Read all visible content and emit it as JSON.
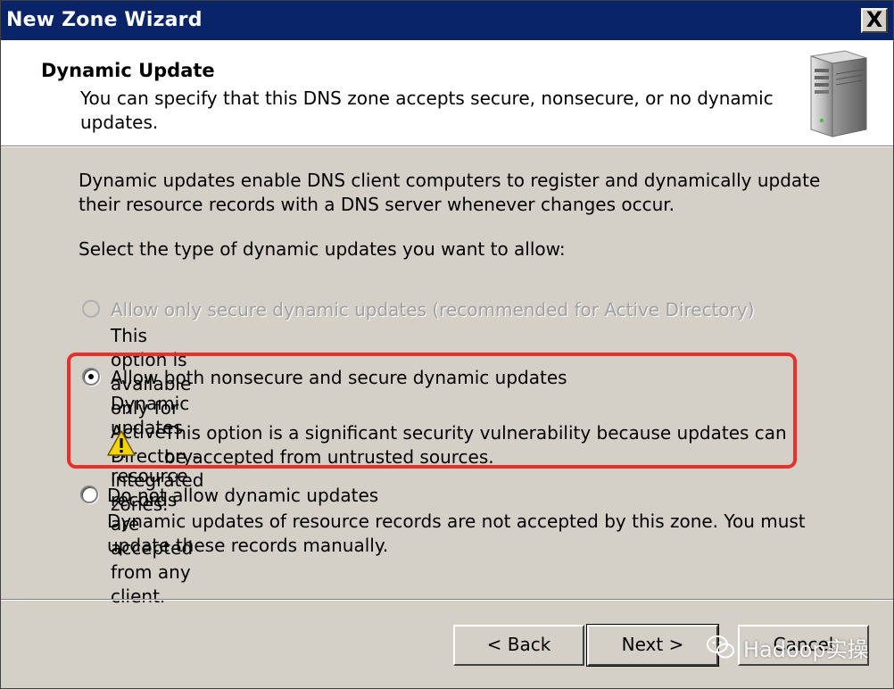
{
  "window": {
    "title": "New Zone Wizard",
    "close_glyph": "X"
  },
  "header": {
    "title": "Dynamic Update",
    "subtitle": "You can specify that this DNS zone accepts secure, nonsecure, or no dynamic updates.",
    "icon": "server-icon"
  },
  "body": {
    "intro": "Dynamic updates enable DNS client computers to register and dynamically update their resource records with a DNS server whenever changes occur.",
    "prompt": "Select the type of dynamic updates you want to allow:"
  },
  "options": [
    {
      "label": "Allow only secure dynamic updates (recommended for Active Directory)",
      "description": "This option is available only for Active Directory-integrated zones.",
      "selected": false,
      "enabled": false
    },
    {
      "label": "Allow both nonsecure and secure dynamic updates",
      "description": "Dynamic updates of resource records are accepted from any client.",
      "warning": "This option is a significant security vulnerability because updates can be accepted from untrusted sources.",
      "selected": true,
      "enabled": true
    },
    {
      "label": "Do not allow dynamic updates",
      "description": "Dynamic updates of resource records are not accepted by this zone. You must update these records manually.",
      "selected": false,
      "enabled": true
    }
  ],
  "buttons": {
    "back": "< Back",
    "next": "Next >",
    "cancel": "Cancel"
  },
  "watermark": {
    "text": "Hadoop实操"
  },
  "colors": {
    "titlebar": "#0a246a",
    "dialog": "#d4d0c8",
    "highlight": "#e8312a",
    "warning": "#f5d300"
  }
}
